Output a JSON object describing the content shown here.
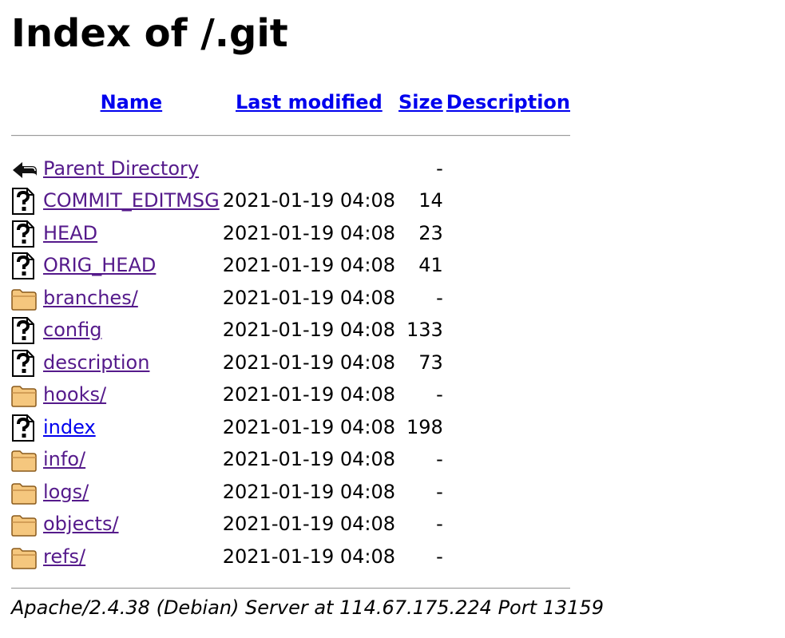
{
  "page": {
    "title": "Index of /.git",
    "footer": "Apache/2.4.38 (Debian) Server at 114.67.175.224 Port 13159"
  },
  "columns": {
    "name": "Name",
    "last_modified": "Last modified",
    "size": "Size",
    "description": "Description"
  },
  "parent": {
    "label": "Parent Directory",
    "size": "-"
  },
  "entries": [
    {
      "name": "COMMIT_EDITMSG",
      "date": "2021-01-19 04:08",
      "size": "14",
      "icon": "unknown-file-icon",
      "visited": true
    },
    {
      "name": "HEAD",
      "date": "2021-01-19 04:08",
      "size": "23",
      "icon": "unknown-file-icon",
      "visited": true
    },
    {
      "name": "ORIG_HEAD",
      "date": "2021-01-19 04:08",
      "size": "41",
      "icon": "unknown-file-icon",
      "visited": true
    },
    {
      "name": "branches/",
      "date": "2021-01-19 04:08",
      "size": "-",
      "icon": "folder-icon",
      "visited": true
    },
    {
      "name": "config",
      "date": "2021-01-19 04:08",
      "size": "133",
      "icon": "unknown-file-icon",
      "visited": true
    },
    {
      "name": "description",
      "date": "2021-01-19 04:08",
      "size": "73",
      "icon": "unknown-file-icon",
      "visited": true
    },
    {
      "name": "hooks/",
      "date": "2021-01-19 04:08",
      "size": "-",
      "icon": "folder-icon",
      "visited": true
    },
    {
      "name": "index",
      "date": "2021-01-19 04:08",
      "size": "198",
      "icon": "unknown-file-icon",
      "visited": false
    },
    {
      "name": "info/",
      "date": "2021-01-19 04:08",
      "size": "-",
      "icon": "folder-icon",
      "visited": true
    },
    {
      "name": "logs/",
      "date": "2021-01-19 04:08",
      "size": "-",
      "icon": "folder-icon",
      "visited": true
    },
    {
      "name": "objects/",
      "date": "2021-01-19 04:08",
      "size": "-",
      "icon": "folder-icon",
      "visited": true
    },
    {
      "name": "refs/",
      "date": "2021-01-19 04:08",
      "size": "-",
      "icon": "folder-icon",
      "visited": true
    }
  ],
  "colors": {
    "link": "#0000ee",
    "visited_link": "#551a8b",
    "folder_fill": "#f5c77e"
  }
}
